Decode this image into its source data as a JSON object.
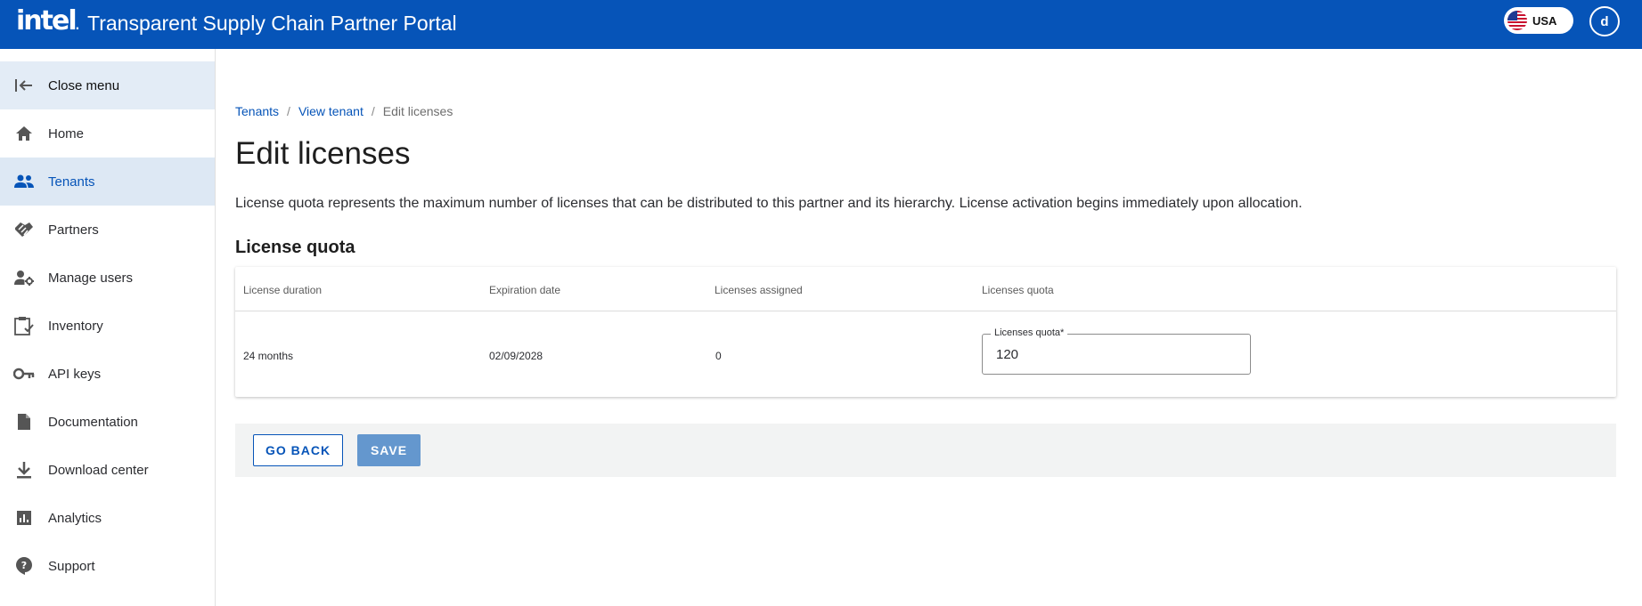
{
  "header": {
    "logo_text": "intel",
    "logo_dot": ".",
    "title": "Transparent Supply Chain Partner Portal",
    "region": "USA",
    "avatar_initial": "d",
    "brand_color": "#0654b8"
  },
  "sidebar": {
    "items": [
      {
        "label": "Close menu",
        "icon": "collapse-menu-icon"
      },
      {
        "label": "Home",
        "icon": "home-icon"
      },
      {
        "label": "Tenants",
        "icon": "people-icon",
        "active": true
      },
      {
        "label": "Partners",
        "icon": "handshake-icon"
      },
      {
        "label": "Manage users",
        "icon": "user-settings-icon"
      },
      {
        "label": "Inventory",
        "icon": "clipboard-check-icon"
      },
      {
        "label": "API keys",
        "icon": "key-icon"
      },
      {
        "label": "Documentation",
        "icon": "document-icon"
      },
      {
        "label": "Download center",
        "icon": "download-icon"
      },
      {
        "label": "Analytics",
        "icon": "analytics-icon"
      },
      {
        "label": "Support",
        "icon": "help-icon"
      }
    ]
  },
  "breadcrumb": {
    "items": [
      "Tenants",
      "View tenant",
      "Edit licenses"
    ],
    "separator": "/"
  },
  "page": {
    "title": "Edit licenses",
    "description": "License quota represents the maximum number of licenses that can be distributed to this partner and its hierarchy. License activation begins immediately upon allocation.",
    "section_title": "License quota"
  },
  "table": {
    "columns": [
      "License duration",
      "Expiration date",
      "Licenses assigned",
      "Licenses quota"
    ],
    "rows": [
      {
        "duration": "24 months",
        "expiration": "02/09/2028",
        "assigned": "0",
        "quota_label": "Licenses quota*",
        "quota_value": "120"
      }
    ]
  },
  "actions": {
    "back_label": "GO BACK",
    "save_label": "SAVE"
  }
}
